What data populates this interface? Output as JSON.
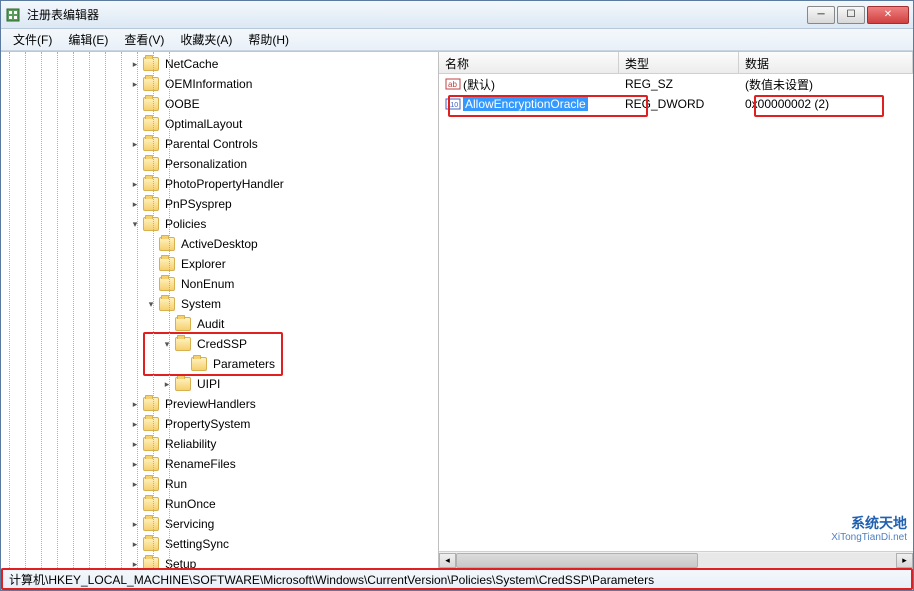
{
  "title": "注册表编辑器",
  "menu": {
    "file": "文件(F)",
    "edit": "编辑(E)",
    "view": "查看(V)",
    "fav": "收藏夹(A)",
    "help": "帮助(H)"
  },
  "tree": [
    {
      "d": 8,
      "t": "c",
      "l": "NetCache"
    },
    {
      "d": 8,
      "t": "c",
      "l": "OEMInformation"
    },
    {
      "d": 8,
      "t": "n",
      "l": "OOBE"
    },
    {
      "d": 8,
      "t": "n",
      "l": "OptimalLayout"
    },
    {
      "d": 8,
      "t": "c",
      "l": "Parental Controls"
    },
    {
      "d": 8,
      "t": "n",
      "l": "Personalization"
    },
    {
      "d": 8,
      "t": "c",
      "l": "PhotoPropertyHandler"
    },
    {
      "d": 8,
      "t": "c",
      "l": "PnPSysprep"
    },
    {
      "d": 8,
      "t": "o",
      "l": "Policies"
    },
    {
      "d": 9,
      "t": "n",
      "l": "ActiveDesktop"
    },
    {
      "d": 9,
      "t": "n",
      "l": "Explorer"
    },
    {
      "d": 9,
      "t": "n",
      "l": "NonEnum"
    },
    {
      "d": 9,
      "t": "o",
      "l": "System"
    },
    {
      "d": 10,
      "t": "n",
      "l": "Audit"
    },
    {
      "d": 10,
      "t": "o",
      "l": "CredSSP",
      "hl": 1
    },
    {
      "d": 11,
      "t": "n",
      "l": "Parameters",
      "hl": 1
    },
    {
      "d": 10,
      "t": "c",
      "l": "UIPI"
    },
    {
      "d": 8,
      "t": "c",
      "l": "PreviewHandlers"
    },
    {
      "d": 8,
      "t": "c",
      "l": "PropertySystem"
    },
    {
      "d": 8,
      "t": "c",
      "l": "Reliability"
    },
    {
      "d": 8,
      "t": "c",
      "l": "RenameFiles"
    },
    {
      "d": 8,
      "t": "c",
      "l": "Run"
    },
    {
      "d": 8,
      "t": "n",
      "l": "RunOnce"
    },
    {
      "d": 8,
      "t": "c",
      "l": "Servicing"
    },
    {
      "d": 8,
      "t": "c",
      "l": "SettingSync"
    },
    {
      "d": 8,
      "t": "c",
      "l": "Setup"
    }
  ],
  "list": {
    "cols": {
      "name": "名称",
      "type": "类型",
      "data": "数据"
    },
    "rows": [
      {
        "icon": "sz",
        "name": "(默认)",
        "type": "REG_SZ",
        "data": "(数值未设置)",
        "sel": false
      },
      {
        "icon": "dw",
        "name": "AllowEncryptionOracle",
        "type": "REG_DWORD",
        "data": "0x00000002 (2)",
        "sel": true
      }
    ]
  },
  "status": "计算机\\HKEY_LOCAL_MACHINE\\SOFTWARE\\Microsoft\\Windows\\CurrentVersion\\Policies\\System\\CredSSP\\Parameters",
  "watermark": {
    "brand": "系统天地",
    "url": "XiTongTianDi.net"
  }
}
